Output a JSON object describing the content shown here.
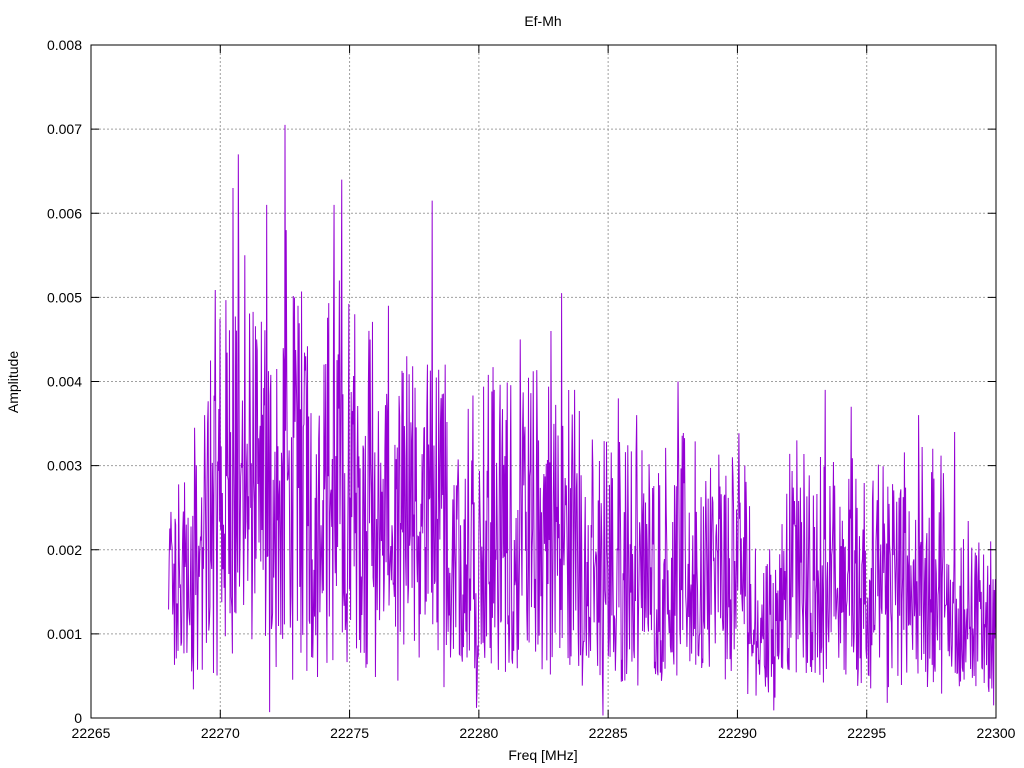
{
  "chart_data": {
    "type": "line",
    "title": "Ef-Mh",
    "xlabel": "Freq [MHz]",
    "ylabel": "Amplitude",
    "xlim": [
      22265,
      22300
    ],
    "ylim": [
      0,
      0.008
    ],
    "x_ticks": [
      22265,
      22270,
      22275,
      22280,
      22285,
      22290,
      22295,
      22300
    ],
    "x_tick_labels": [
      "22265",
      "22270",
      "22275",
      "22280",
      "22285",
      "22290",
      "22295",
      "22300"
    ],
    "y_ticks": [
      0,
      0.001,
      0.002,
      0.003,
      0.004,
      0.005,
      0.006,
      0.007,
      0.008
    ],
    "y_tick_labels": [
      "0",
      "0.001",
      "0.002",
      "0.003",
      "0.004",
      "0.005",
      "0.006",
      "0.007",
      "0.008"
    ],
    "grid": true,
    "legend": "none",
    "series_color": "#9400d3",
    "series": [
      {
        "x_start": 22268,
        "x_end": 22300,
        "peaks": [
          {
            "x": 22268.1,
            "y": 0.00245
          },
          {
            "x": 22269.0,
            "y": 0.00345
          },
          {
            "x": 22269.4,
            "y": 0.0036
          },
          {
            "x": 22270.5,
            "y": 0.0063
          },
          {
            "x": 22270.7,
            "y": 0.0067
          },
          {
            "x": 22270.95,
            "y": 0.0055
          },
          {
            "x": 22271.4,
            "y": 0.0045
          },
          {
            "x": 22271.8,
            "y": 0.0061
          },
          {
            "x": 22271.9,
            "y": 0.0056
          },
          {
            "x": 22272.5,
            "y": 0.00705
          },
          {
            "x": 22272.55,
            "y": 0.0058
          },
          {
            "x": 22273.0,
            "y": 0.0049
          },
          {
            "x": 22273.3,
            "y": 0.0043
          },
          {
            "x": 22274.0,
            "y": 0.0042
          },
          {
            "x": 22274.4,
            "y": 0.0061
          },
          {
            "x": 22274.7,
            "y": 0.0064
          },
          {
            "x": 22274.6,
            "y": 0.0052
          },
          {
            "x": 22275.2,
            "y": 0.0048
          },
          {
            "x": 22275.8,
            "y": 0.0045
          },
          {
            "x": 22276.5,
            "y": 0.0049
          },
          {
            "x": 22277.2,
            "y": 0.0043
          },
          {
            "x": 22278.0,
            "y": 0.0042
          },
          {
            "x": 22278.2,
            "y": 0.00615
          },
          {
            "x": 22278.7,
            "y": 0.0042
          },
          {
            "x": 22280.6,
            "y": 0.0039
          },
          {
            "x": 22281.6,
            "y": 0.0045
          },
          {
            "x": 22282.8,
            "y": 0.0046
          },
          {
            "x": 22283.2,
            "y": 0.00505
          },
          {
            "x": 22283.7,
            "y": 0.0039
          },
          {
            "x": 22285.4,
            "y": 0.0038
          },
          {
            "x": 22286.1,
            "y": 0.0036
          },
          {
            "x": 22287.7,
            "y": 0.004
          },
          {
            "x": 22289.8,
            "y": 0.0031
          },
          {
            "x": 22292.3,
            "y": 0.0033
          },
          {
            "x": 22293.4,
            "y": 0.0039
          },
          {
            "x": 22294.4,
            "y": 0.0037
          },
          {
            "x": 22297.0,
            "y": 0.0036
          },
          {
            "x": 22298.4,
            "y": 0.0034
          },
          {
            "x": 22299.8,
            "y": 0.0021
          }
        ],
        "dips": [
          {
            "x": 22271.9,
            "y": 7e-05
          },
          {
            "x": 22279.9,
            "y": 0.00012
          },
          {
            "x": 22284.8,
            "y": 3e-05
          },
          {
            "x": 22291.4,
            "y": 9e-05
          },
          {
            "x": 22295.8,
            "y": 0.00018
          },
          {
            "x": 22299.9,
            "y": 0.00015
          }
        ]
      }
    ]
  }
}
